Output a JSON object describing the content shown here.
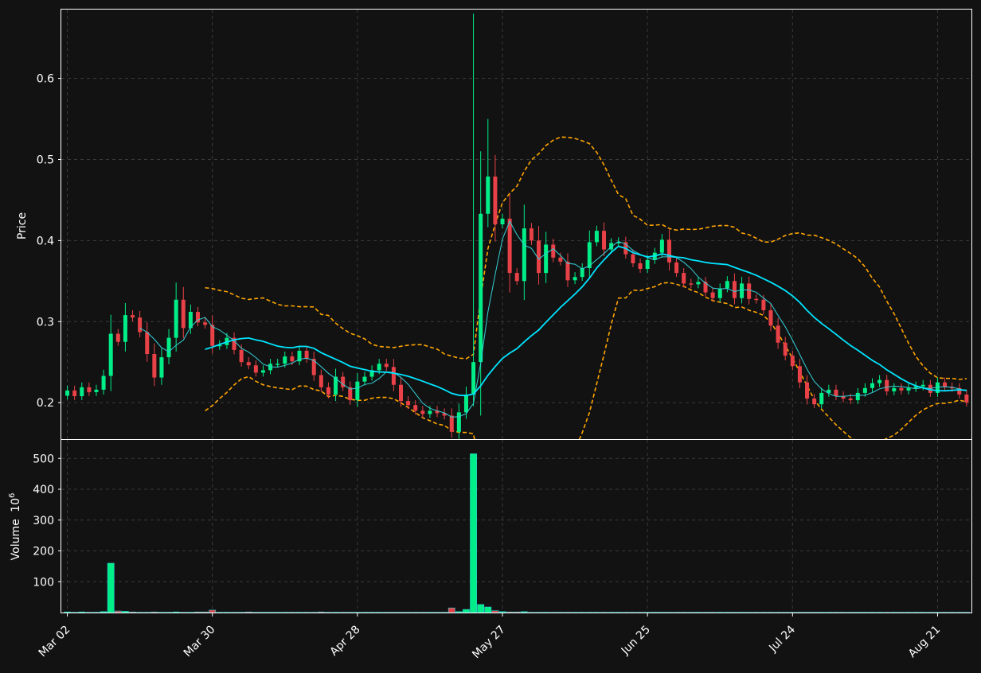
{
  "chart_data": {
    "type": "candlestick",
    "ylabel": "Price",
    "volume_label": "Volume",
    "volume_exponent": "10",
    "volume_exponent_power": "6",
    "price_ticks": [
      {
        "v": 0.2,
        "label": "0.2"
      },
      {
        "v": 0.3,
        "label": "0.3"
      },
      {
        "v": 0.4,
        "label": "0.4"
      },
      {
        "v": 0.5,
        "label": "0.5"
      },
      {
        "v": 0.6,
        "label": "0.6"
      }
    ],
    "volume_ticks": [
      {
        "v": 100,
        "label": "100"
      },
      {
        "v": 200,
        "label": "200"
      },
      {
        "v": 300,
        "label": "300"
      },
      {
        "v": 400,
        "label": "400"
      },
      {
        "v": 500,
        "label": "500"
      }
    ],
    "x_ticks": [
      {
        "i": 0,
        "label": "Mar 02"
      },
      {
        "i": 20,
        "label": "Mar 30"
      },
      {
        "i": 40,
        "label": "Apr 28"
      },
      {
        "i": 60,
        "label": "May 27"
      },
      {
        "i": 80,
        "label": "Jun 25"
      },
      {
        "i": 100,
        "label": "Jul 24"
      },
      {
        "i": 120,
        "label": "Aug 21"
      }
    ],
    "price_ylim": [
      0.155,
      0.685
    ],
    "volume_ylim": [
      0,
      560
    ],
    "grid": true,
    "colors": {
      "up": "#00ee88",
      "down": "#e84147",
      "ma_fast": "#33d1d8",
      "ma_slow": "#00e5ff",
      "band": "#ffa500",
      "background": "#121212",
      "grid": "#3a3a3a",
      "text": "#ffffff"
    },
    "ma_fast_period": 5,
    "ma_slow_period": 20,
    "closes": [
      0.215,
      0.208,
      0.219,
      0.213,
      0.216,
      0.233,
      0.285,
      0.275,
      0.308,
      0.305,
      0.287,
      0.26,
      0.231,
      0.256,
      0.28,
      0.327,
      0.292,
      0.312,
      0.299,
      0.296,
      0.27,
      0.271,
      0.28,
      0.265,
      0.25,
      0.246,
      0.237,
      0.24,
      0.248,
      0.248,
      0.257,
      0.251,
      0.264,
      0.254,
      0.234,
      0.219,
      0.21,
      0.232,
      0.219,
      0.203,
      0.226,
      0.232,
      0.24,
      0.248,
      0.244,
      0.222,
      0.202,
      0.197,
      0.19,
      0.186,
      0.19,
      0.187,
      0.184,
      0.164,
      0.188,
      0.21,
      0.25,
      0.433,
      0.479,
      0.42,
      0.427,
      0.36,
      0.35,
      0.415,
      0.4,
      0.36,
      0.395,
      0.379,
      0.374,
      0.351,
      0.355,
      0.366,
      0.398,
      0.412,
      0.389,
      0.397,
      0.398,
      0.383,
      0.372,
      0.365,
      0.376,
      0.385,
      0.401,
      0.373,
      0.36,
      0.347,
      0.346,
      0.349,
      0.336,
      0.329,
      0.341,
      0.35,
      0.329,
      0.347,
      0.328,
      0.327,
      0.314,
      0.295,
      0.274,
      0.258,
      0.245,
      0.225,
      0.205,
      0.198,
      0.212,
      0.216,
      0.208,
      0.205,
      0.203,
      0.212,
      0.218,
      0.224,
      0.228,
      0.214,
      0.218,
      0.215,
      0.218,
      0.22,
      0.222,
      0.212,
      0.225,
      0.219,
      0.218,
      0.21,
      0.2
    ],
    "volumes": [
      2,
      1,
      2,
      1,
      1,
      3,
      160,
      5,
      4,
      2,
      1,
      1,
      2,
      1,
      1,
      2,
      1,
      1,
      2,
      2,
      8,
      1,
      1,
      1,
      1,
      2,
      1,
      1,
      1,
      1,
      1,
      1,
      1,
      1,
      1,
      2,
      1,
      1,
      1,
      1,
      1,
      1,
      1,
      1,
      1,
      1,
      1,
      1,
      1,
      1,
      1,
      1,
      1,
      15,
      3,
      10,
      515,
      26,
      18,
      6,
      3,
      2,
      2,
      3,
      1,
      1,
      1,
      1,
      1,
      1,
      1,
      1,
      1,
      1,
      1,
      1,
      1,
      1,
      1,
      1,
      1,
      1,
      1,
      1,
      1,
      1,
      1,
      1,
      1,
      1,
      1,
      1,
      1,
      1,
      1,
      1,
      1,
      1,
      1,
      1,
      1,
      1,
      1,
      1,
      1,
      1,
      1,
      1,
      1,
      1,
      1,
      1,
      1,
      1,
      1,
      1,
      1,
      1,
      1,
      1,
      1,
      1,
      1,
      1,
      1
    ]
  }
}
